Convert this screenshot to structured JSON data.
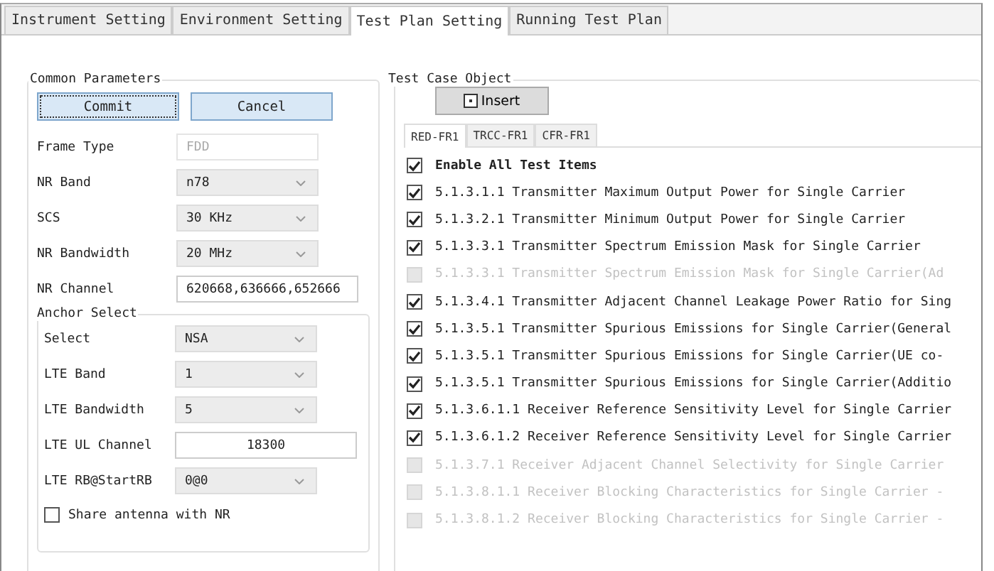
{
  "tabs": [
    {
      "label": "Instrument Setting",
      "selected": false
    },
    {
      "label": "Environment Setting",
      "selected": false
    },
    {
      "label": "Test Plan Setting",
      "selected": true
    },
    {
      "label": "Running Test Plan",
      "selected": false
    }
  ],
  "common_parameters": {
    "title": "Common Parameters",
    "buttons": [
      "Commit",
      "Cancel"
    ],
    "fields": [
      {
        "kind": "text",
        "label": "Frame Type",
        "value": "FDD",
        "disabled": true
      },
      {
        "kind": "dropdown",
        "label": "NR Band",
        "value": "n78",
        "disabled": false
      },
      {
        "kind": "dropdown",
        "label": "SCS",
        "value": "30 KHz",
        "disabled": false
      },
      {
        "kind": "dropdown",
        "label": "NR Bandwidth",
        "value": "20 MHz",
        "disabled": false
      },
      {
        "kind": "text",
        "label": "NR Channel",
        "value": "620668,636666,652666",
        "disabled": false
      }
    ],
    "anchor_select": {
      "title": "Anchor Select",
      "fields": [
        {
          "kind": "dropdown",
          "label": "Select",
          "value": "NSA"
        },
        {
          "kind": "dropdown",
          "label": "LTE Band",
          "value": "1"
        },
        {
          "kind": "dropdown",
          "label": "LTE Bandwidth",
          "value": "5"
        },
        {
          "kind": "text",
          "label": "LTE UL Channel",
          "value": "18300"
        },
        {
          "kind": "dropdown",
          "label": "LTE RB@StartRB",
          "value": "0@0"
        }
      ],
      "share_antenna": {
        "label": "Share antenna with NR",
        "checked": false
      }
    }
  },
  "test_case_object": {
    "title": "Test Case Object",
    "insert_button": "Insert",
    "tabs": [
      {
        "label": "RED-FR1",
        "selected": true
      },
      {
        "label": "TRCC-FR1",
        "selected": false
      },
      {
        "label": "CFR-FR1",
        "selected": false
      }
    ],
    "items": [
      {
        "label": "Enable All Test Items",
        "checked": true,
        "disabled": false,
        "bold": true
      },
      {
        "label": "5.1.3.1.1 Transmitter Maximum Output Power for Single Carrier",
        "checked": true,
        "disabled": false
      },
      {
        "label": "5.1.3.2.1 Transmitter Minimum Output Power for Single Carrier",
        "checked": true,
        "disabled": false
      },
      {
        "label": "5.1.3.3.1 Transmitter Spectrum Emission Mask for Single Carrier",
        "checked": true,
        "disabled": false
      },
      {
        "label": "5.1.3.3.1 Transmitter Spectrum Emission Mask for Single Carrier(Ad",
        "checked": false,
        "disabled": true
      },
      {
        "label": "5.1.3.4.1 Transmitter Adjacent Channel Leakage Power Ratio for Sing",
        "checked": true,
        "disabled": false
      },
      {
        "label": "5.1.3.5.1 Transmitter Spurious Emissions for Single Carrier(General",
        "checked": true,
        "disabled": false
      },
      {
        "label": "5.1.3.5.1 Transmitter Spurious Emissions for Single Carrier(UE co-",
        "checked": true,
        "disabled": false
      },
      {
        "label": "5.1.3.5.1 Transmitter Spurious Emissions for Single Carrier(Additio",
        "checked": true,
        "disabled": false
      },
      {
        "label": "5.1.3.6.1.1 Receiver Reference Sensitivity Level for Single Carrier",
        "checked": true,
        "disabled": false
      },
      {
        "label": "5.1.3.6.1.2 Receiver Reference Sensitivity Level for Single Carrier",
        "checked": true,
        "disabled": false
      },
      {
        "label": "5.1.3.7.1 Receiver Adjacent Channel Selectivity for Single Carrier",
        "checked": false,
        "disabled": true
      },
      {
        "label": "5.1.3.8.1.1 Receiver Blocking Characteristics for Single Carrier -",
        "checked": false,
        "disabled": true
      },
      {
        "label": "5.1.3.8.1.2 Receiver Blocking Characteristics for Single Carrier -",
        "checked": false,
        "disabled": true
      }
    ]
  }
}
